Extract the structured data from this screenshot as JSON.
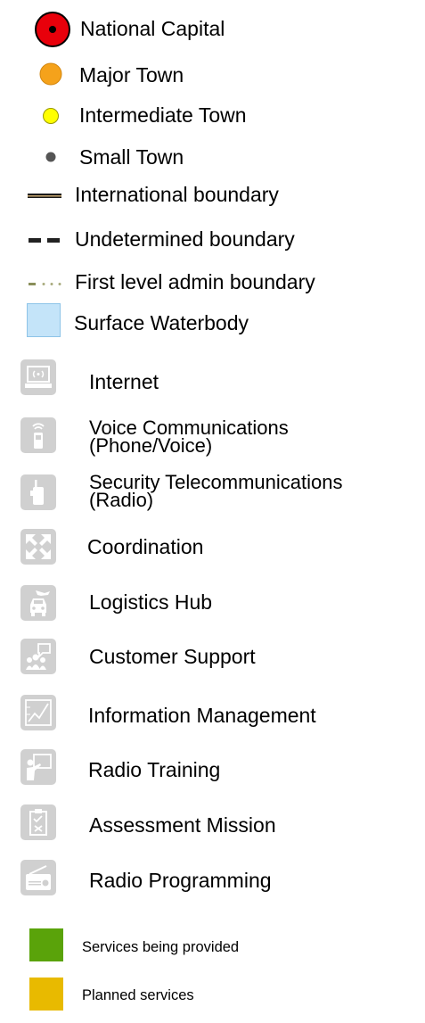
{
  "legend": {
    "settlements": {
      "national_capital": "National Capital",
      "major_town": "Major Town",
      "intermediate_town": "Intermediate Town",
      "small_town": "Small Town"
    },
    "boundaries": {
      "international": "International boundary",
      "undetermined": "Undetermined boundary",
      "first_level": "First level admin boundary"
    },
    "water": {
      "surface_waterbody": "Surface Waterbody"
    },
    "services": [
      {
        "icon": "internet-icon",
        "label": "Internet"
      },
      {
        "icon": "phone-icon",
        "label_line1": "Voice Communications",
        "label_line2": "(Phone/Voice)"
      },
      {
        "icon": "radio-icon",
        "label_line1": "Security Telecommunications",
        "label_line2": "(Radio)"
      },
      {
        "icon": "coordination-icon",
        "label": "Coordination"
      },
      {
        "icon": "logistics-hub-icon",
        "label": "Logistics Hub"
      },
      {
        "icon": "customer-support-icon",
        "label": "Customer Support"
      },
      {
        "icon": "information-management-icon",
        "label": "Information Management"
      },
      {
        "icon": "radio-training-icon",
        "label": "Radio Training"
      },
      {
        "icon": "assessment-mission-icon",
        "label": "Assessment Mission"
      },
      {
        "icon": "radio-programming-icon",
        "label": "Radio Programming"
      }
    ],
    "status": {
      "provided": {
        "label": "Services being provided",
        "color": "#5aa30a"
      },
      "planned": {
        "label": "Planned services",
        "color": "#e8ba00"
      }
    },
    "colors": {
      "capital_fill": "#e8000b",
      "major_town_fill": "#f5a21b",
      "intermediate_town_fill": "#ffff00",
      "small_town_fill": "#555555",
      "waterbody_fill": "#c4e4f9",
      "icon_tile": "#d0d0d0"
    }
  }
}
